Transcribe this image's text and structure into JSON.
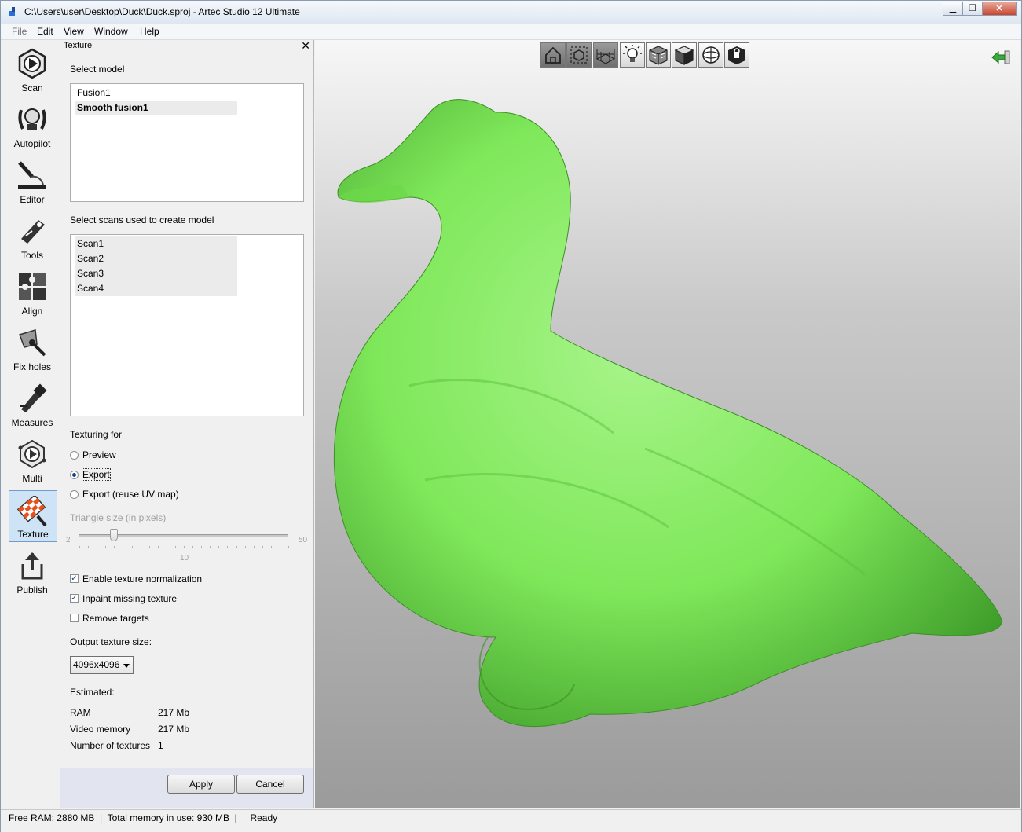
{
  "window": {
    "title": "C:\\Users\\user\\Desktop\\Duck\\Duck.sproj - Artec Studio 12 Ultimate",
    "minimize": "▁",
    "maximize": "❐",
    "close": "✕"
  },
  "menu": {
    "items": [
      "File",
      "Edit",
      "View",
      "Window",
      "Help"
    ]
  },
  "toolbar": {
    "items": [
      {
        "label": "Scan",
        "icon": "scan-icon"
      },
      {
        "label": "Autopilot",
        "icon": "autopilot-icon"
      },
      {
        "label": "Editor",
        "icon": "editor-icon"
      },
      {
        "label": "Tools",
        "icon": "tools-icon"
      },
      {
        "label": "Align",
        "icon": "align-icon"
      },
      {
        "label": "Fix holes",
        "icon": "fix-holes-icon"
      },
      {
        "label": "Measures",
        "icon": "measures-icon"
      },
      {
        "label": "Multi",
        "icon": "multi-icon"
      },
      {
        "label": "Texture",
        "icon": "texture-icon",
        "active": true
      },
      {
        "label": "Publish",
        "icon": "publish-icon"
      }
    ]
  },
  "panel": {
    "title": "Texture",
    "close": "✕",
    "select_model_label": "Select model",
    "models": [
      "Fusion1",
      "Smooth fusion1"
    ],
    "selected_model": "Smooth fusion1",
    "select_scans_label": "Select scans used to create model",
    "scans": [
      "Scan1",
      "Scan2",
      "Scan3",
      "Scan4"
    ],
    "texturing_for_label": "Texturing for",
    "texturing_options": [
      "Preview",
      "Export",
      "Export (reuse UV map)"
    ],
    "texturing_selected": "Export",
    "triangle_size_label": "Triangle size (in pixels)",
    "slider": {
      "min": "2",
      "max": "50",
      "value": "10",
      "min_num": 2,
      "max_num": 50,
      "value_num": 10
    },
    "options": [
      {
        "label": "Enable texture normalization",
        "checked": true
      },
      {
        "label": "Inpaint missing texture",
        "checked": true
      },
      {
        "label": "Remove targets",
        "checked": false
      }
    ],
    "output_size_label": "Output texture size:",
    "output_size_value": "4096x4096",
    "estimated_label": "Estimated:",
    "estimates": [
      {
        "label": "RAM",
        "value": "217 Mb"
      },
      {
        "label": "Video memory",
        "value": "217 Mb"
      },
      {
        "label": "Number of textures",
        "value": "1"
      }
    ],
    "apply": "Apply",
    "cancel": "Cancel"
  },
  "viewport": {
    "tools": [
      "home-icon",
      "fit-view-icon",
      "grid-icon",
      "light-icon",
      "textured-cube-icon",
      "shaded-cube-icon",
      "sphere-icon",
      "lock-cube-icon"
    ],
    "model_color": "#7fe85a",
    "collapse_icon": "collapse-arrow-icon"
  },
  "status": {
    "text": "Free RAM: 2880 MB  |  Total memory in use: 930 MB  |     Ready"
  }
}
